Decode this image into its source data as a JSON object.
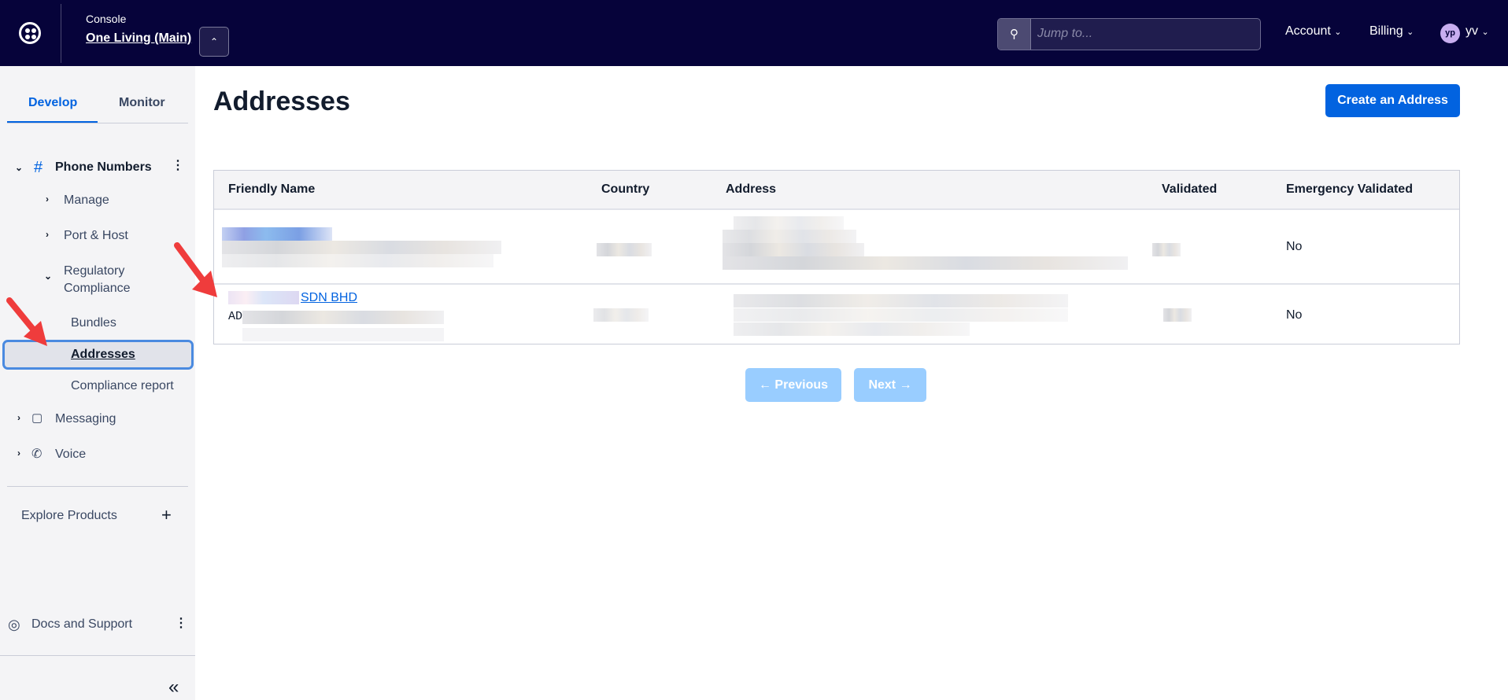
{
  "header": {
    "console_label": "Console",
    "account_name": "One Living (Main)",
    "search_placeholder": "Jump to...",
    "account_menu": "Account",
    "billing_menu": "Billing",
    "avatar_initials": "yp",
    "user": "yv"
  },
  "sidebar": {
    "tabs": [
      "Develop",
      "Monitor"
    ],
    "section": "Phone Numbers",
    "items": {
      "manage": "Manage",
      "port_host": "Port & Host",
      "regulatory": "Regulatory Compliance",
      "bundles": "Bundles",
      "addresses": "Addresses",
      "compliance_report": "Compliance report",
      "messaging": "Messaging",
      "voice": "Voice"
    },
    "explore": "Explore Products",
    "docs": "Docs and Support"
  },
  "main": {
    "title": "Addresses",
    "create_button": "Create an Address",
    "columns": [
      "Friendly Name",
      "Country",
      "Address",
      "Validated",
      "Emergency Validated"
    ],
    "rows": [
      {
        "emergency": "No"
      },
      {
        "name_suffix": "SDN BHD",
        "name_sub_prefix": "AD",
        "emergency": "No"
      }
    ],
    "pagination": {
      "previous": "← Previous",
      "next": "Next →"
    }
  },
  "colors": {
    "topbar": "#06033a",
    "accent": "#0263e0",
    "arrow": "#ef3c3c"
  }
}
